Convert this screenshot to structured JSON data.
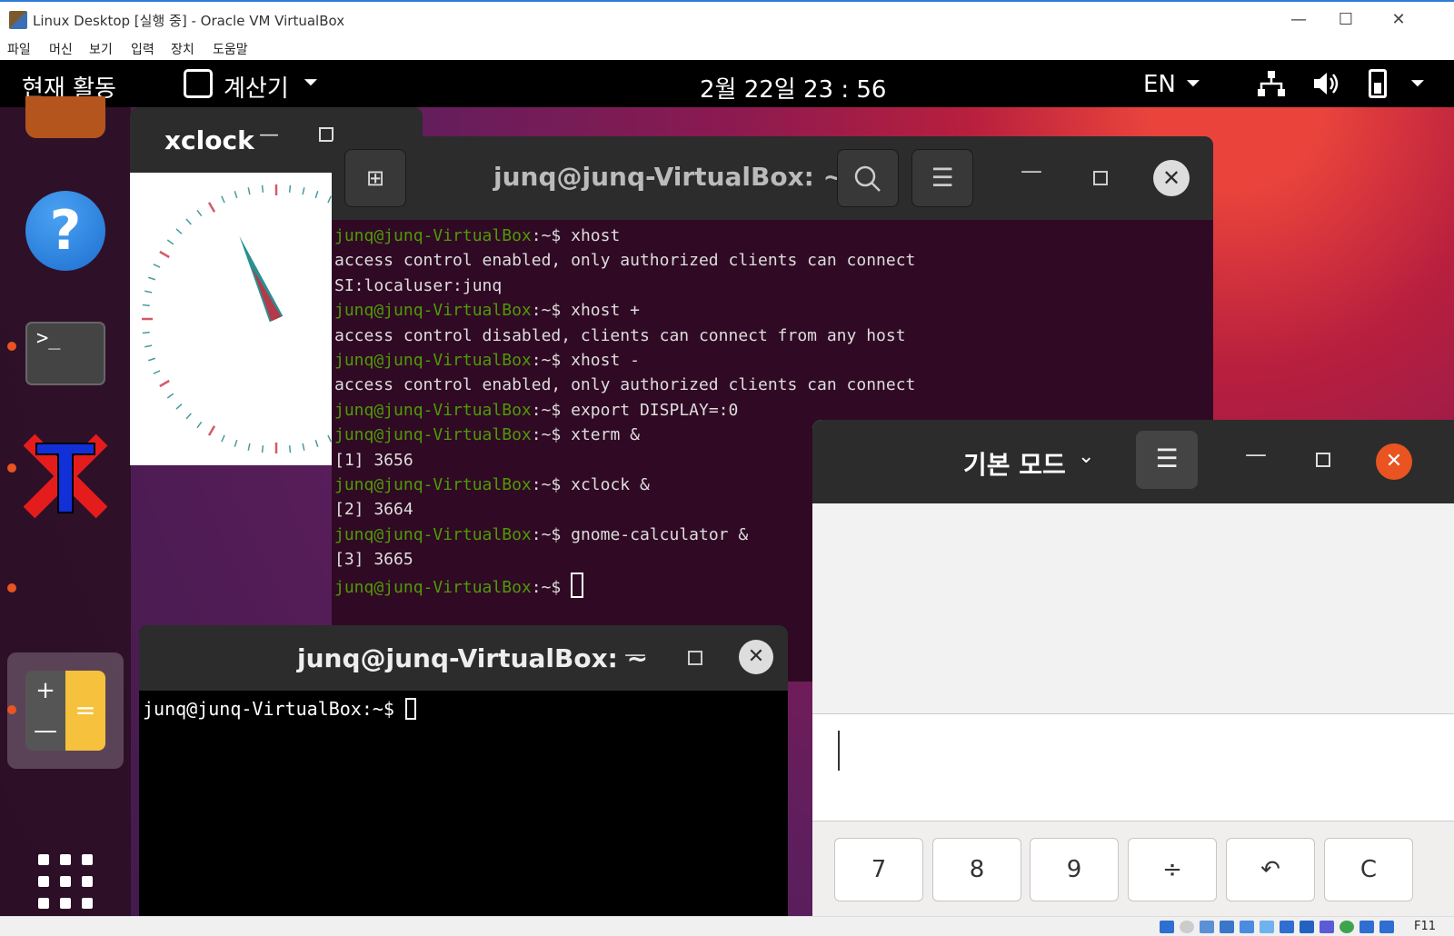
{
  "vbox": {
    "title": "Linux Desktop [실행 중] - Oracle VM VirtualBox",
    "menu": [
      "파일",
      "머신",
      "보기",
      "입력",
      "장치",
      "도움말"
    ],
    "controls": {
      "minimize": "—",
      "maximize": "☐",
      "close": "✕"
    },
    "host_key": "F11"
  },
  "topbar": {
    "activities": "현재 활동",
    "app_name": "계산기",
    "clock": "2월 22일  23 : 56",
    "lang": "EN",
    "caret": "⏷",
    "icons": {
      "network": "network-icon",
      "volume": "volume-icon",
      "battery": "battery-icon"
    }
  },
  "dock": {
    "help_glyph": "?",
    "terminal_glyph": ">_",
    "calc_plus": "+",
    "calc_minus": "—",
    "calc_equals": "="
  },
  "xclock": {
    "title": "xclock",
    "min": "—",
    "hour_deg": 335,
    "minute_deg": 336
  },
  "gterm": {
    "title": "junq@junq-VirtualBox: ~",
    "new_tab": "⊞",
    "search": "⌕",
    "menu": "☰",
    "min": "—",
    "close": "✕",
    "prompt": "junq@junq-VirtualBox",
    "lines": [
      {
        "type": "cmd",
        "text": "xhost"
      },
      {
        "type": "out",
        "text": "access control enabled, only authorized clients can connect"
      },
      {
        "type": "out",
        "text": "SI:localuser:junq"
      },
      {
        "type": "cmd",
        "text": "xhost +"
      },
      {
        "type": "out",
        "text": "access control disabled, clients can connect from any host"
      },
      {
        "type": "cmd",
        "text": "xhost -"
      },
      {
        "type": "out",
        "text": "access control enabled, only authorized clients can connect"
      },
      {
        "type": "cmd",
        "text": "export DISPLAY=:0"
      },
      {
        "type": "cmd",
        "text": "xterm &"
      },
      {
        "type": "out",
        "text": "[1] 3656"
      },
      {
        "type": "cmd",
        "text": "xclock &"
      },
      {
        "type": "out",
        "text": "[2] 3664"
      },
      {
        "type": "cmd",
        "text": "gnome-calculator &"
      },
      {
        "type": "out",
        "text": "[3] 3665"
      },
      {
        "type": "prompt",
        "text": ""
      }
    ]
  },
  "xterm": {
    "title": "junq@junq-VirtualBox: ~",
    "min": "—",
    "close": "✕",
    "prompt": "junq@junq-VirtualBox:~$ "
  },
  "calc": {
    "mode": "기본 모드",
    "mode_caret": "⌄",
    "menu": "☰",
    "min": "—",
    "close": "✕",
    "keys": [
      "7",
      "8",
      "9",
      "÷",
      "↶",
      "C"
    ]
  },
  "colors": {
    "accent": "#e95420",
    "prompt_green": "#4e9a06",
    "terminal_bg": "#300a24"
  }
}
